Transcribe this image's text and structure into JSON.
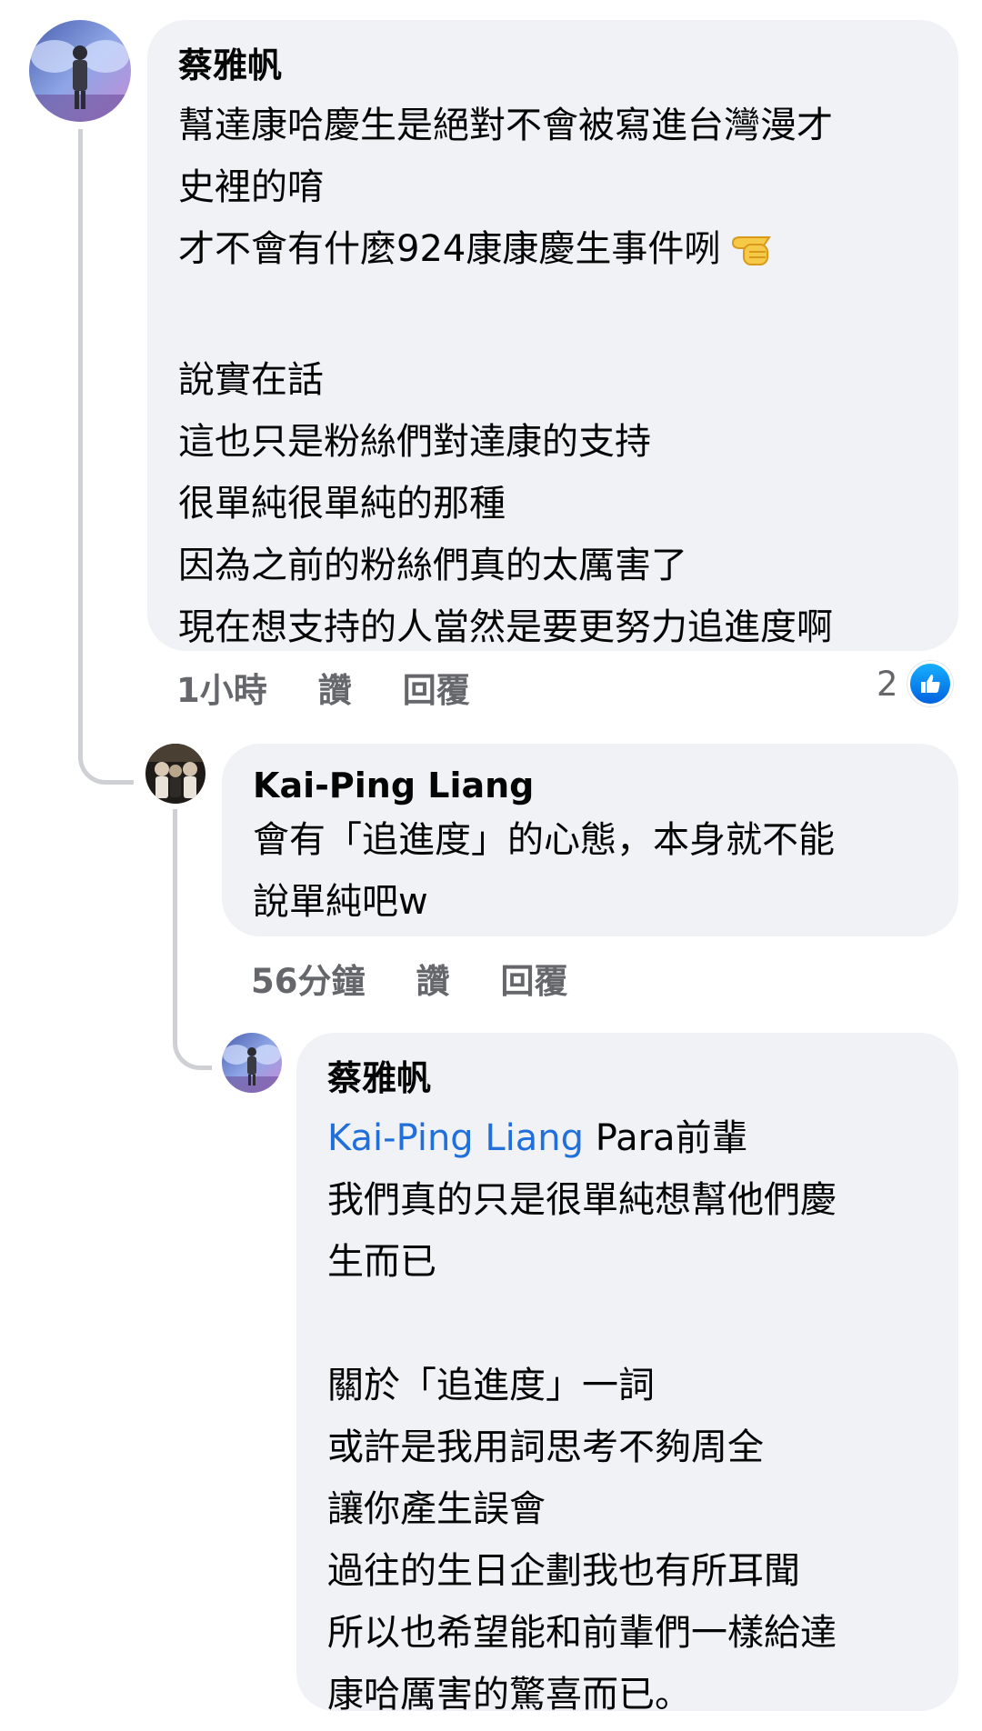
{
  "comment": {
    "author": "蔡雅帆",
    "lines": [
      "幫達康哈慶生是絕對不會被寫進台灣漫才",
      "史裡的唷",
      "才不會有什麼924康康慶生事件咧",
      "",
      "說實在話",
      "這也只是粉絲們對達康的支持",
      "很單純很單純的那種",
      "因為之前的粉絲們真的太厲害了",
      "現在想支持的人當然是要更努力追進度啊"
    ],
    "emoji_icon": "backhand-index-pointing-left-icon",
    "time": "1小時",
    "like_label": "讚",
    "reply_label": "回覆",
    "reaction_count": "2",
    "reaction_icon": "like-thumbs-up-icon"
  },
  "reply1": {
    "author": "Kai-Ping Liang",
    "lines": [
      "會有「追進度」的心態，本身就不能",
      "說單純吧w"
    ],
    "time": "56分鐘",
    "like_label": "讚",
    "reply_label": "回覆"
  },
  "reply2": {
    "author": "蔡雅帆",
    "mention": "Kai-Ping Liang",
    "mention_suffix": " Para前輩",
    "lines": [
      "我們真的只是很單純想幫他們慶",
      "生而已",
      "",
      "關於「追進度」一詞",
      "或許是我用詞思考不夠周全",
      "讓你產生誤會",
      "過往的生日企劃我也有所耳聞",
      "所以也希望能和前輩們一樣給達",
      "康哈厲害的驚喜而已。"
    ]
  },
  "colors": {
    "bubble": "#f0f2f5",
    "meta_text": "#65676b",
    "mention": "#216fdb",
    "like_blue": "#0866ff",
    "thread_line": "#ced0d4"
  }
}
